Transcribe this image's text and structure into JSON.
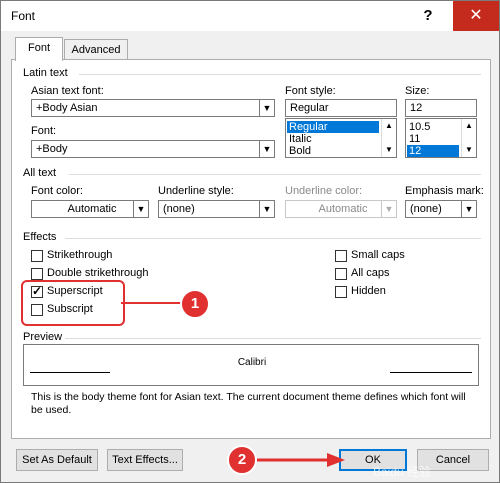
{
  "window": {
    "title": "Font",
    "help_label": "?",
    "close_label": "✕"
  },
  "tabs": [
    {
      "label": "Font"
    },
    {
      "label": "Advanced"
    }
  ],
  "latin": {
    "section_label": "Latin text",
    "asian_label": "Asian text font:",
    "asian_value": "+Body Asian",
    "font_label": "Font:",
    "font_value": "+Body",
    "style_label": "Font style:",
    "style_value": "Regular",
    "style_options": [
      "Regular",
      "Italic",
      "Bold"
    ],
    "size_label": "Size:",
    "size_value": "12",
    "size_options": [
      "10.5",
      "11",
      "12"
    ]
  },
  "alltext": {
    "section_label": "All text",
    "color_label": "Font color:",
    "color_value": "Automatic",
    "underline_label": "Underline style:",
    "underline_value": "(none)",
    "ucolor_label": "Underline color:",
    "ucolor_value": "Automatic",
    "emphasis_label": "Emphasis mark:",
    "emphasis_value": "(none)"
  },
  "effects": {
    "section_label": "Effects",
    "items": [
      {
        "label": "Strikethrough",
        "checked": false
      },
      {
        "label": "Double strikethrough",
        "checked": false
      },
      {
        "label": "Superscript",
        "checked": true
      },
      {
        "label": "Subscript",
        "checked": false
      },
      {
        "label": "Small caps",
        "checked": false
      },
      {
        "label": "All caps",
        "checked": false
      },
      {
        "label": "Hidden",
        "checked": false
      }
    ]
  },
  "preview": {
    "section_label": "Preview",
    "sample": "Calibri",
    "description": "This is the body theme font for Asian text. The current document theme defines which font will be used."
  },
  "buttons": {
    "default_label": "Set As Default",
    "effects_label": "Text Effects...",
    "ok_label": "OK",
    "cancel_label": "Cancel"
  },
  "annotations": {
    "badge1": "1",
    "badge2": "2",
    "watermark": "Baidu 经验"
  },
  "colors": {
    "accent": "#0078d7",
    "annotation": "#e03030",
    "close": "#c42b1c"
  }
}
